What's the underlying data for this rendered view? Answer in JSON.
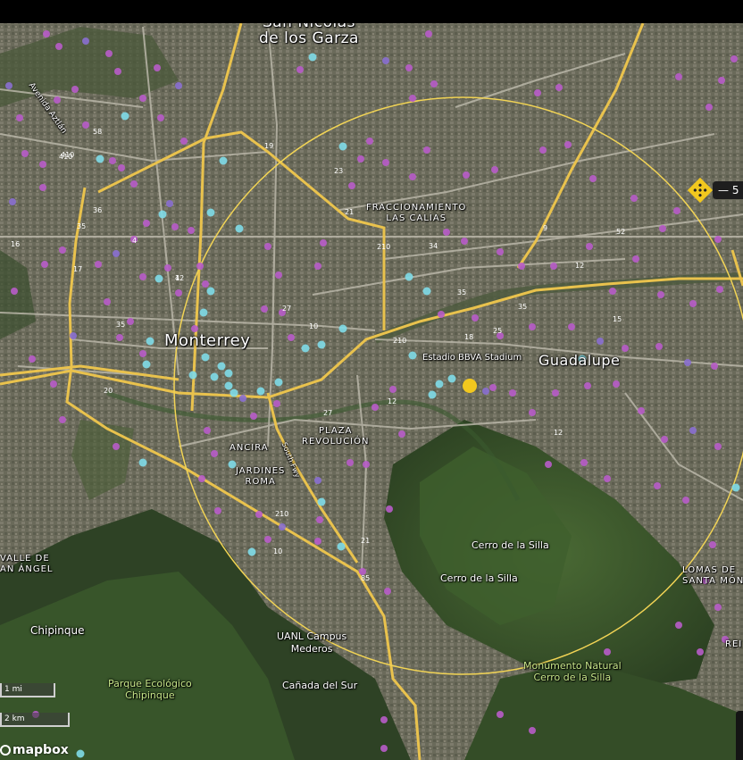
{
  "map": {
    "provider_logo": "mapbox",
    "cities": [
      {
        "key": "san-nicolas",
        "text": "San Nicolás\nde los Garza"
      },
      {
        "key": "monterrey",
        "text": "Monterrey"
      },
      {
        "key": "guadalupe",
        "text": "Guadalupe"
      }
    ],
    "neighborhoods": {
      "fraccionamiento": "FRACCIONAMIENTO\nLAS CALIAS",
      "plaza": "PLAZA\nREVOLUCIÓN",
      "ancira": "ANCIRA",
      "jardines": "JARDINES\nROMA",
      "valle": "VALLE DE\nAN ÁNGEL",
      "lomas": "LOMAS DE\nSANTA MÓNI",
      "rei": "REI"
    },
    "places": {
      "estadio": "Estadio BBVA Stadium",
      "cerro1": "Cerro de la Silla",
      "cerro2": "Cerro de la Silla",
      "chipinque": "Chipinque",
      "uanl": "UANL Campus\nMederos",
      "canada": "Cañada del Sur",
      "avenida": "Avenida Aztlán",
      "south_fwy": "South Fwy"
    },
    "parks": {
      "chipinque_park": "Parque Ecológico\nChipinque",
      "monumento": "Monumento Natural\nCerro de la Silla"
    },
    "road_numbers": [
      "58",
      "410",
      "36",
      "35",
      "4",
      "17",
      "12",
      "16",
      "35",
      "19",
      "23",
      "21",
      "210",
      "34",
      "9",
      "27",
      "10",
      "210",
      "18",
      "25",
      "35",
      "35",
      "20",
      "15",
      "12",
      "27",
      "12",
      "12",
      "210",
      "10",
      "21",
      "85",
      "410",
      "52",
      "4"
    ],
    "scale": {
      "miles": "1 mi",
      "km": "2 km"
    },
    "controls": {
      "zoom_out": "—",
      "zoom_value": "5"
    },
    "colors": {
      "radius_circle": "#f2d455",
      "highway": "#e9c24d",
      "search_center": "#f2c81e",
      "poi_magenta": "#b85cc9",
      "poi_purple": "#8a6fd0",
      "poi_cyan": "#7fdbe8",
      "vegetation": "#3c5a2a"
    }
  }
}
